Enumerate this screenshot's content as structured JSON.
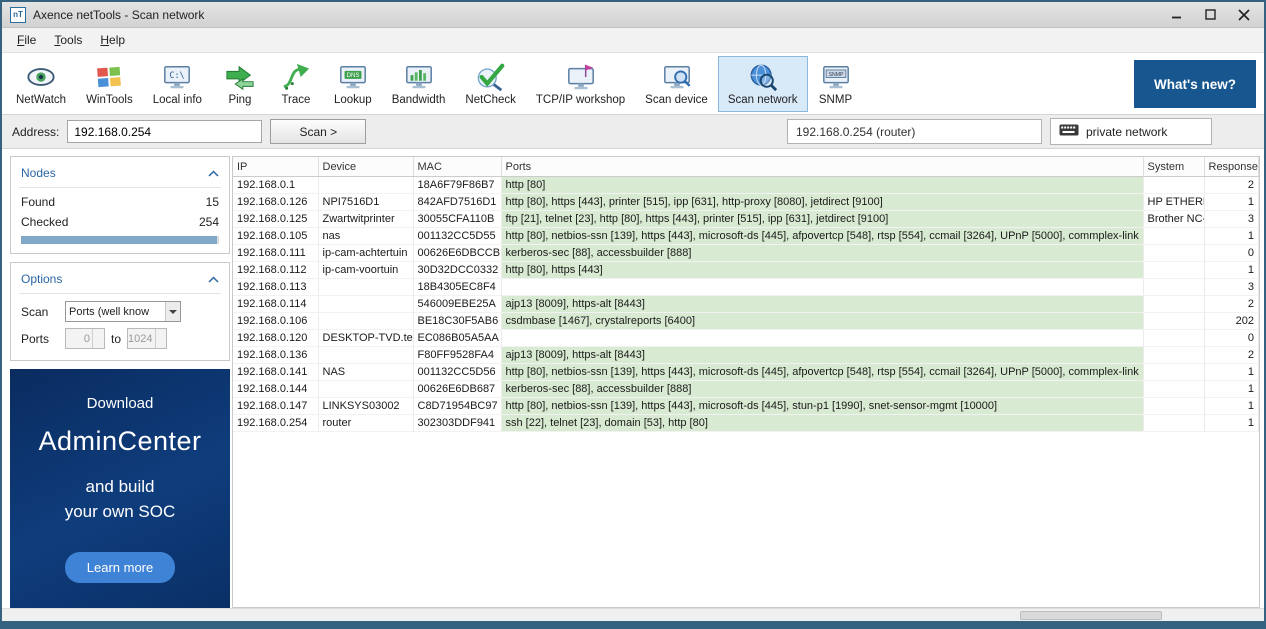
{
  "window": {
    "title": "Axence netTools - Scan network",
    "app_icon_text": "nT"
  },
  "menu": {
    "items": [
      "File",
      "Tools",
      "Help"
    ]
  },
  "toolbar": {
    "whats_new": "What's new?",
    "items": [
      {
        "label": "NetWatch",
        "icon": "netwatch-eye-icon",
        "selected": false
      },
      {
        "label": "WinTools",
        "icon": "wintools-windows-icon",
        "selected": false
      },
      {
        "label": "Local info",
        "icon": "local-info-icon",
        "selected": false
      },
      {
        "label": "Ping",
        "icon": "ping-icon",
        "selected": false
      },
      {
        "label": "Trace",
        "icon": "trace-icon",
        "selected": false
      },
      {
        "label": "Lookup",
        "icon": "dns-lookup-icon",
        "selected": false
      },
      {
        "label": "Bandwidth",
        "icon": "bandwidth-icon",
        "selected": false
      },
      {
        "label": "NetCheck",
        "icon": "netcheck-icon",
        "selected": false
      },
      {
        "label": "TCP/IP workshop",
        "icon": "tcpip-workshop-icon",
        "selected": false
      },
      {
        "label": "Scan device",
        "icon": "scan-device-icon",
        "selected": false
      },
      {
        "label": "Scan network",
        "icon": "scan-network-icon",
        "selected": true
      },
      {
        "label": "SNMP",
        "icon": "snmp-icon",
        "selected": false
      }
    ]
  },
  "address_bar": {
    "label": "Address:",
    "value": "192.168.0.254",
    "scan_button": "Scan >",
    "resolved": "192.168.0.254 (router)",
    "network_label": "private network"
  },
  "sidebar": {
    "nodes": {
      "title": "Nodes",
      "found_label": "Found",
      "found": "15",
      "checked_label": "Checked",
      "checked": "254",
      "progress_pct": 99
    },
    "options": {
      "title": "Options",
      "scan_label": "Scan",
      "scan_value": "Ports (well know",
      "ports_label": "Ports",
      "port_from": "0",
      "to_label": "to",
      "port_to": "1024"
    },
    "ad": {
      "line1": "Download",
      "line2": "AdminCenter",
      "line3": "and build",
      "line4": "your own SOC",
      "button": "Learn more"
    }
  },
  "table": {
    "columns": [
      "IP",
      "Device",
      "MAC",
      "Ports",
      "System",
      "Response"
    ],
    "rows": [
      {
        "ip": "192.168.0.1",
        "device": "",
        "mac": "18A6F79F86B7",
        "ports": "http [80]",
        "system": "",
        "response": "2"
      },
      {
        "ip": "192.168.0.126",
        "device": "NPI7516D1",
        "mac": "842AFD7516D1",
        "ports": "http [80], https [443], printer [515], ipp [631], http-proxy [8080], jetdirect [9100]",
        "system": "HP ETHERN",
        "response": "1"
      },
      {
        "ip": "192.168.0.125",
        "device": "Zwartwitprinter",
        "mac": "30055CFA110B",
        "ports": "ftp [21], telnet [23], http [80], https [443], printer [515], ipp [631], jetdirect [9100]",
        "system": "Brother NC-",
        "response": "3"
      },
      {
        "ip": "192.168.0.105",
        "device": "nas",
        "mac": "001132CC5D55",
        "ports": "http [80], netbios-ssn [139], https [443], microsoft-ds [445], afpovertcp [548], rtsp [554], ccmail [3264], UPnP [5000], commplex-link",
        "system": "",
        "response": "1"
      },
      {
        "ip": "192.168.0.111",
        "device": "ip-cam-achtertuin",
        "mac": "00626E6DBCCB",
        "ports": "kerberos-sec [88], accessbuilder [888]",
        "system": "",
        "response": "0"
      },
      {
        "ip": "192.168.0.112",
        "device": "ip-cam-voortuin",
        "mac": "30D32DCC0332",
        "ports": "http [80], https [443]",
        "system": "",
        "response": "1"
      },
      {
        "ip": "192.168.0.113",
        "device": "",
        "mac": "18B4305EC8F4",
        "ports": "",
        "system": "",
        "response": "3"
      },
      {
        "ip": "192.168.0.114",
        "device": "",
        "mac": "546009EBE25A",
        "ports": "ajp13 [8009], https-alt [8443]",
        "system": "",
        "response": "2"
      },
      {
        "ip": "192.168.0.106",
        "device": "",
        "mac": "BE18C30F5AB6",
        "ports": "csdmbase [1467], crystalreports [6400]",
        "system": "",
        "response": "202"
      },
      {
        "ip": "192.168.0.120",
        "device": "DESKTOP-TVD.tele",
        "mac": "EC086B05A5AA",
        "ports": "",
        "system": "",
        "response": "0"
      },
      {
        "ip": "192.168.0.136",
        "device": "",
        "mac": "F80FF9528FA4",
        "ports": "ajp13 [8009], https-alt [8443]",
        "system": "",
        "response": "2"
      },
      {
        "ip": "192.168.0.141",
        "device": "NAS",
        "mac": "001132CC5D56",
        "ports": "http [80], netbios-ssn [139], https [443], microsoft-ds [445], afpovertcp [548], rtsp [554], ccmail [3264], UPnP [5000], commplex-link",
        "system": "",
        "response": "1"
      },
      {
        "ip": "192.168.0.144",
        "device": "",
        "mac": "00626E6DB687",
        "ports": "kerberos-sec [88], accessbuilder [888]",
        "system": "",
        "response": "1"
      },
      {
        "ip": "192.168.0.147",
        "device": "LINKSYS03002",
        "mac": "C8D71954BC97",
        "ports": "http [80], netbios-ssn [139], https [443], microsoft-ds [445], stun-p1 [1990], snet-sensor-mgmt [10000]",
        "system": "",
        "response": "1"
      },
      {
        "ip": "192.168.0.254",
        "device": "router",
        "mac": "302303DDF941",
        "ports": "ssh [22], telnet [23], domain [53], http [80]",
        "system": "",
        "response": "1"
      }
    ]
  }
}
